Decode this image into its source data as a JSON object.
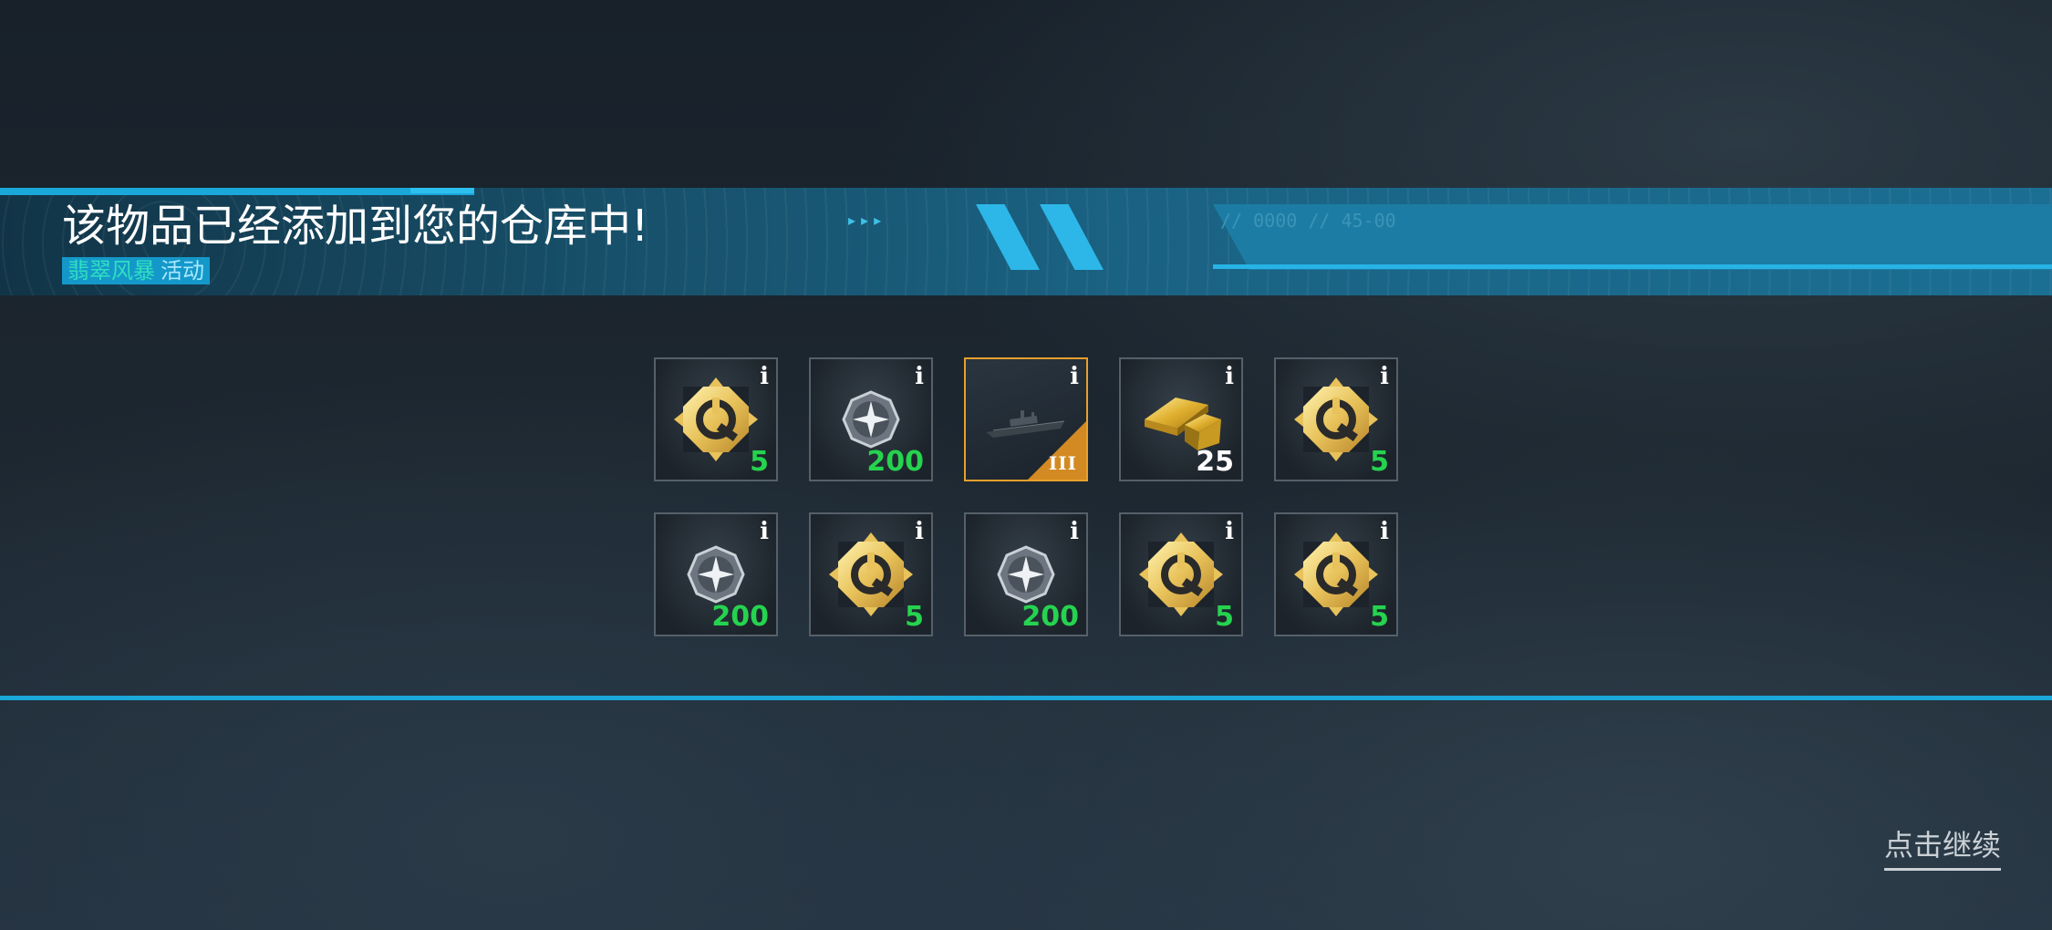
{
  "header": {
    "title": "该物品已经添加到您的仓库中!",
    "event_name": "翡翠风暴",
    "event_suffix": "活动",
    "deco_arrows": "▸▸▸",
    "deco_code": "// 0000 // 45-00"
  },
  "rewards": [
    {
      "icon": "repair-kit-icon",
      "quantity": "5",
      "info": "i"
    },
    {
      "icon": "compass-medal-icon",
      "quantity": "200",
      "info": "i"
    },
    {
      "icon": "warship-icon",
      "tier": "III",
      "info": "i"
    },
    {
      "icon": "gold-bars-icon",
      "quantity": "25",
      "info": "i"
    },
    {
      "icon": "repair-kit-icon",
      "quantity": "5",
      "info": "i"
    },
    {
      "icon": "compass-medal-icon",
      "quantity": "200",
      "info": "i"
    },
    {
      "icon": "repair-kit-icon",
      "quantity": "5",
      "info": "i"
    },
    {
      "icon": "compass-medal-icon",
      "quantity": "200",
      "info": "i"
    },
    {
      "icon": "repair-kit-icon",
      "quantity": "5",
      "info": "i"
    },
    {
      "icon": "repair-kit-icon",
      "quantity": "5",
      "info": "i"
    }
  ],
  "footer": {
    "continue_label": "点击继续"
  },
  "colors": {
    "accent": "#1aa7d9",
    "quantity_green": "#25d34f",
    "highlight_orange": "#e8a02c"
  }
}
